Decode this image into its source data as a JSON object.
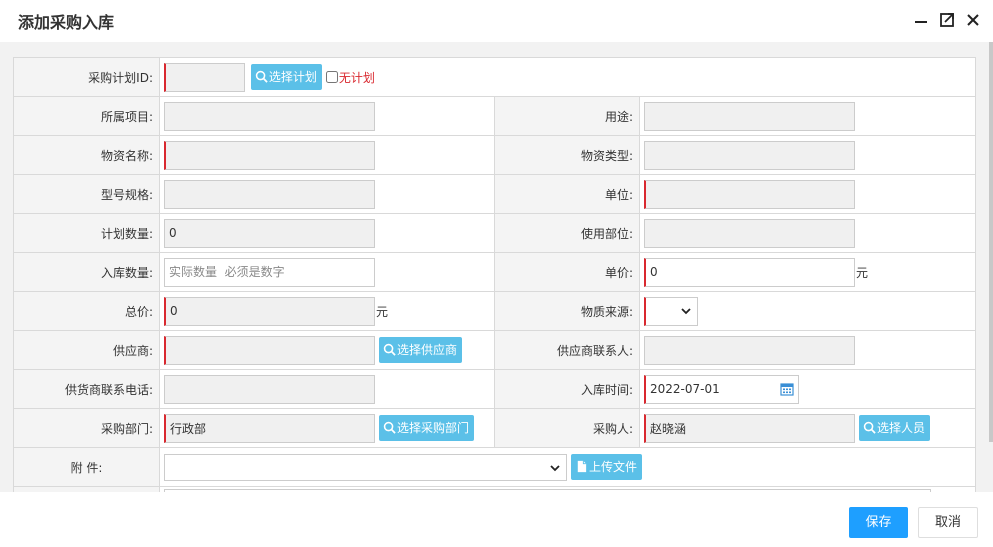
{
  "dialog": {
    "title": "添加采购入库"
  },
  "window_controls": {
    "minimize_icon": "minimize-icon",
    "maximize_icon": "maximize-icon",
    "close_icon": "close-icon"
  },
  "form": {
    "plan_id": {
      "label": "采购计划ID:",
      "value": "",
      "select_button": "选择计划",
      "no_plan_label": "无计划"
    },
    "project": {
      "label": "所属项目:",
      "value": ""
    },
    "purpose": {
      "label": "用途:",
      "value": ""
    },
    "material_name": {
      "label": "物资名称:",
      "value": ""
    },
    "material_type": {
      "label": "物资类型:",
      "value": ""
    },
    "model_spec": {
      "label": "型号规格:",
      "value": ""
    },
    "unit": {
      "label": "单位:",
      "value": ""
    },
    "planned_qty": {
      "label": "计划数量:",
      "value": "0"
    },
    "using_dept": {
      "label": "使用部位:",
      "value": ""
    },
    "stock_in_qty": {
      "label": "入库数量:",
      "value": "",
      "placeholder": "实际数量  必须是数字"
    },
    "unit_price": {
      "label": "单价:",
      "value": "0",
      "unit": "元"
    },
    "total_price": {
      "label": "总价:",
      "value": "0",
      "unit": "元"
    },
    "material_source": {
      "label": "物质来源:",
      "value": ""
    },
    "supplier": {
      "label": "供应商:",
      "value": "",
      "select_button": "选择供应商"
    },
    "supplier_contact": {
      "label": "供应商联系人:",
      "value": ""
    },
    "supplier_phone": {
      "label": "供货商联系电话:",
      "value": ""
    },
    "stock_in_time": {
      "label": "入库时间:",
      "value": "2022-07-01"
    },
    "purchase_dept": {
      "label": "采购部门:",
      "value": "行政部",
      "select_button": "选择采购部门"
    },
    "purchaser": {
      "label": "采购人:",
      "value": "赵晓涵",
      "select_button": "选择人员"
    },
    "attachment": {
      "label": "附 件:",
      "value": "",
      "upload_button": "上传文件"
    }
  },
  "footer": {
    "save_label": "保存",
    "cancel_label": "取消"
  },
  "colors": {
    "accent": "#1e9fff",
    "button_blue": "#5bc0e8",
    "required": "#d9282f"
  }
}
